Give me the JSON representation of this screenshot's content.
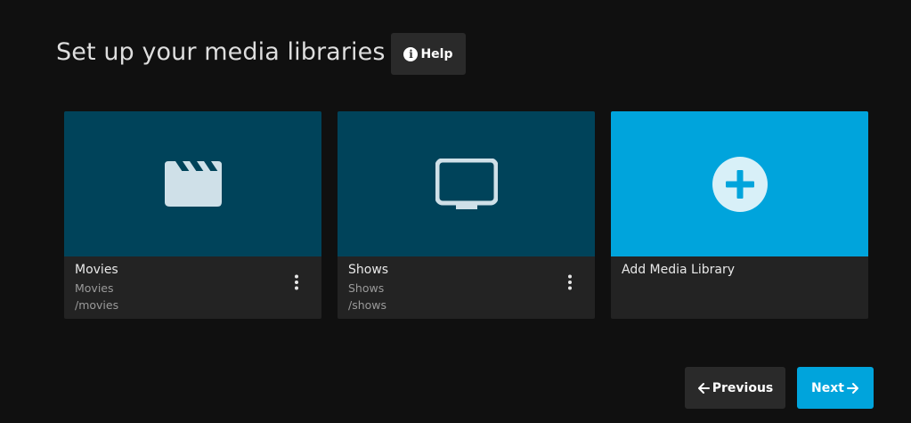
{
  "header": {
    "title": "Set up your media libraries",
    "help_label": "Help"
  },
  "libraries": [
    {
      "name": "Movies",
      "type": "Movies",
      "path": "/movies",
      "icon": "movie-clapperboard-icon"
    },
    {
      "name": "Shows",
      "type": "Shows",
      "path": "/shows",
      "icon": "tv-icon"
    }
  ],
  "add_card": {
    "label": "Add Media Library",
    "icon": "add-circle-icon"
  },
  "footer": {
    "previous_label": "Previous",
    "next_label": "Next"
  },
  "colors": {
    "background": "#101010",
    "card_image_dark": "#00435a",
    "accent": "#00a4dc",
    "card_body": "#232323",
    "button_secondary": "#2a2a2a"
  }
}
